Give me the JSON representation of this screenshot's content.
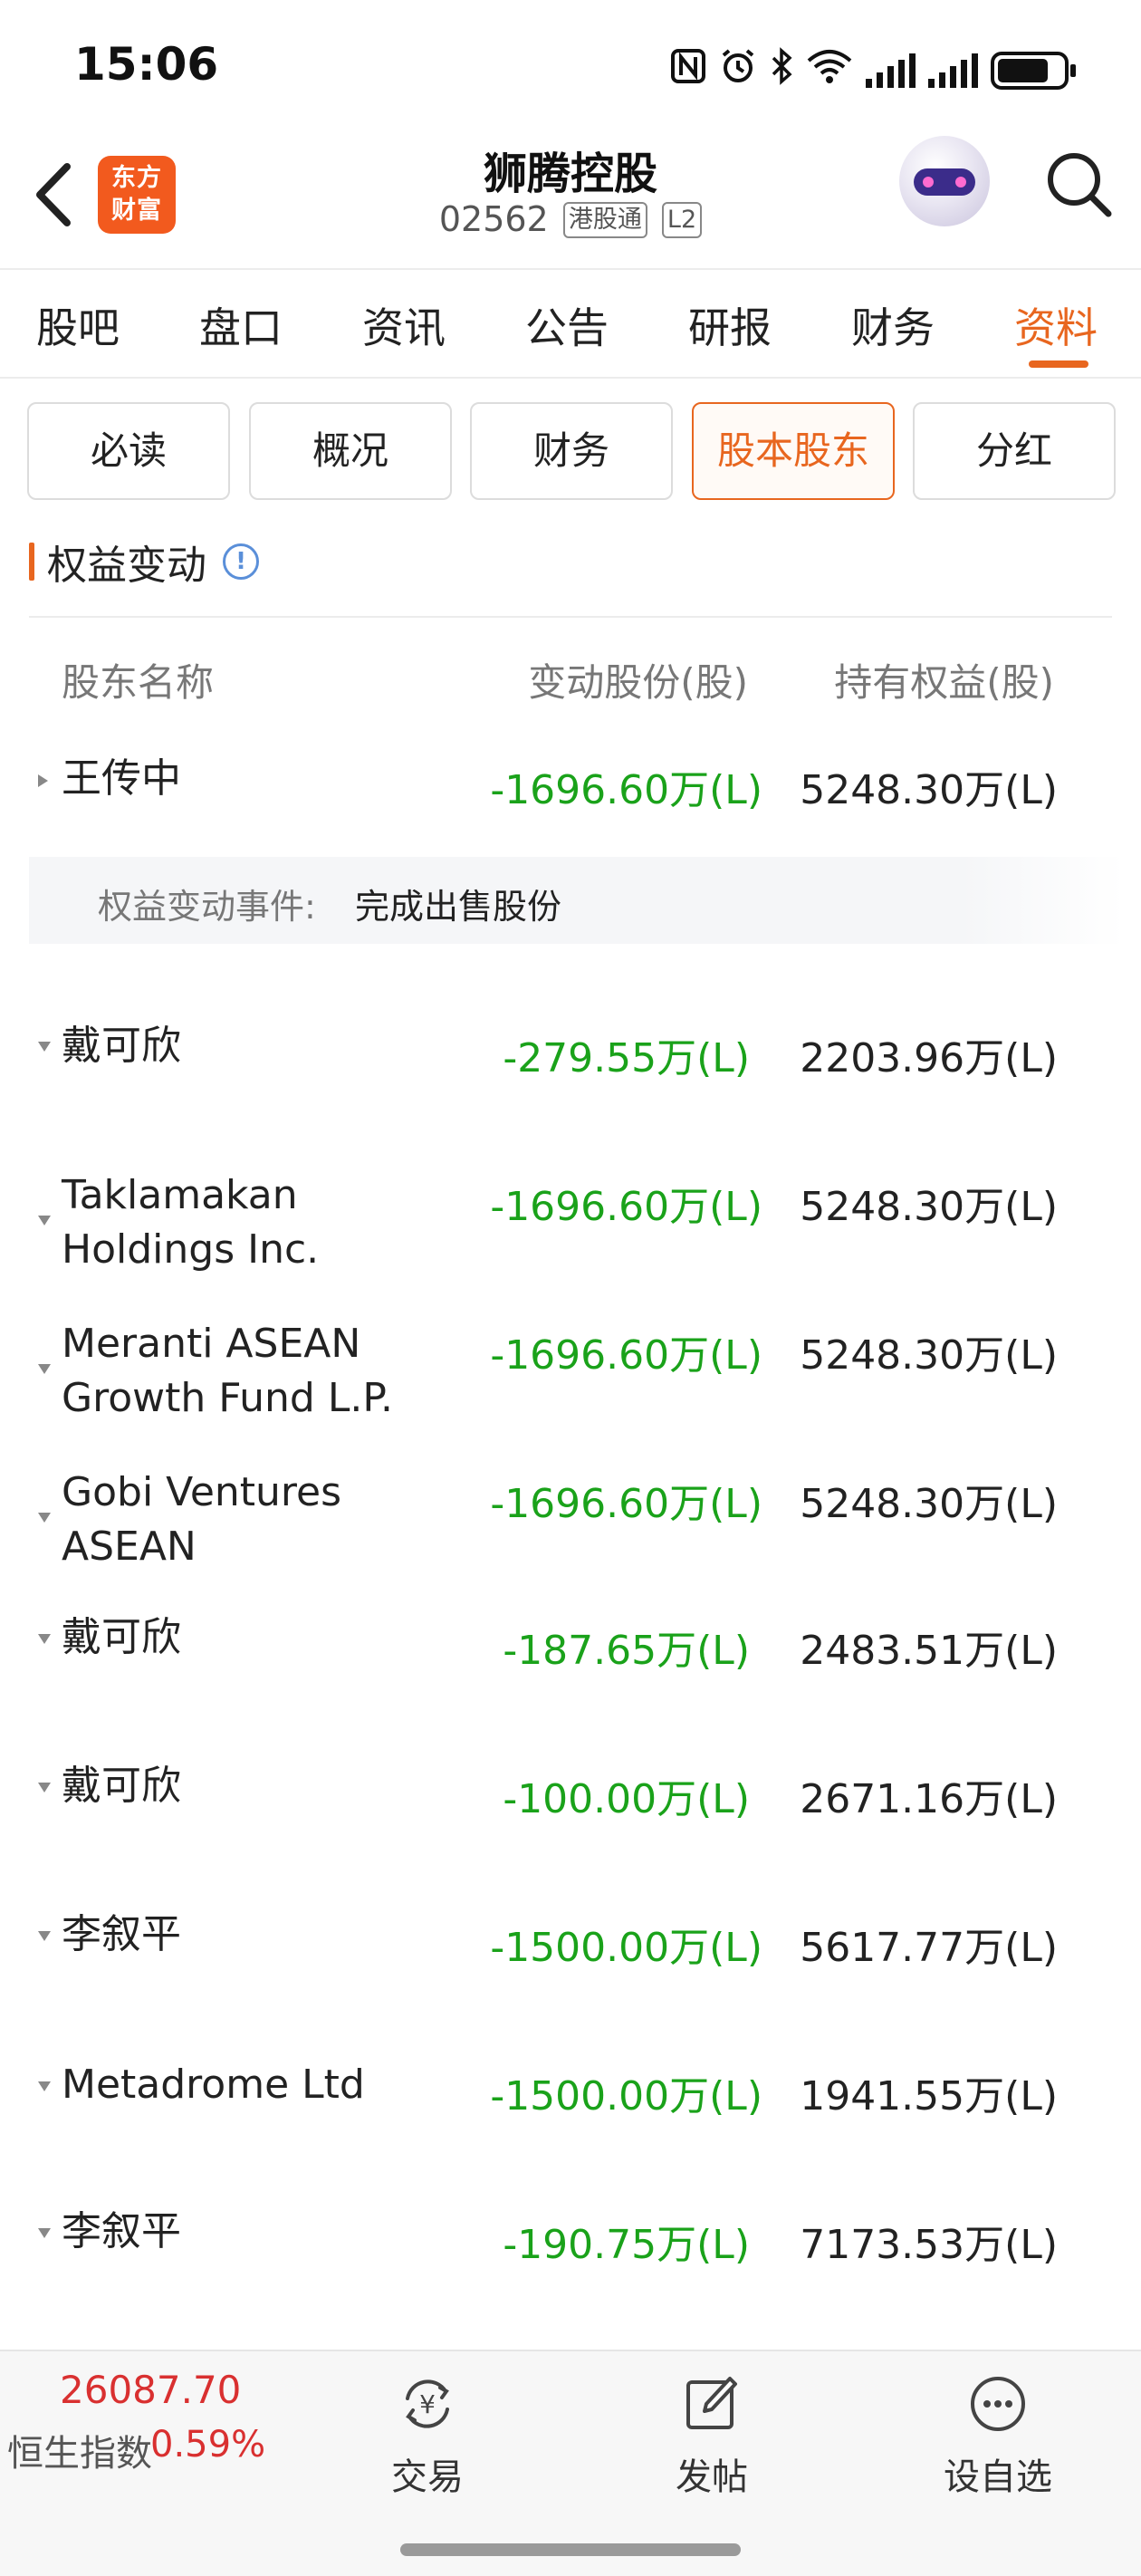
{
  "status": {
    "time": "15:06"
  },
  "header": {
    "logo_line1": "东方",
    "logo_line2": "财富",
    "stock_name": "狮腾控股",
    "stock_code": "02562",
    "tag_connect": "港股通",
    "tag_level": "L2"
  },
  "main_tabs": [
    {
      "label": "股吧"
    },
    {
      "label": "盘口"
    },
    {
      "label": "资讯"
    },
    {
      "label": "公告"
    },
    {
      "label": "研报"
    },
    {
      "label": "财务"
    },
    {
      "label": "资料",
      "active": true
    }
  ],
  "sub_tabs": [
    {
      "label": "必读"
    },
    {
      "label": "概况"
    },
    {
      "label": "财务"
    },
    {
      "label": "股本股东",
      "active": true
    },
    {
      "label": "分红"
    }
  ],
  "section": {
    "title": "权益变动",
    "info": "!"
  },
  "table": {
    "headers": {
      "name": "股东名称",
      "change": "变动股份(股)",
      "holding": "持有权益(股)"
    },
    "rows": [
      {
        "name": "王传中",
        "change": "-1696.60万(L)",
        "holding": "5248.30万(L)",
        "expanded": true
      },
      {
        "name": "戴可欣",
        "change": "-279.55万(L)",
        "holding": "2203.96万(L)"
      },
      {
        "name": "Taklamakan Holdings Inc.",
        "name_line1": "Taklamakan",
        "name_line2": "Holdings Inc.",
        "change": "-1696.60万(L)",
        "holding": "5248.30万(L)"
      },
      {
        "name": "Meranti ASEAN Growth Fund L.P.",
        "name_line1": "Meranti ASEAN",
        "name_line2": "Growth Fund L.P.",
        "change": "-1696.60万(L)",
        "holding": "5248.30万(L)"
      },
      {
        "name": "Gobi Ventures ASEAN",
        "name_line1": "Gobi Ventures",
        "name_line2": "ASEAN",
        "change": "-1696.60万(L)",
        "holding": "5248.30万(L)"
      },
      {
        "name": "戴可欣",
        "change": "-187.65万(L)",
        "holding": "2483.51万(L)"
      },
      {
        "name": "戴可欣",
        "change": "-100.00万(L)",
        "holding": "2671.16万(L)"
      },
      {
        "name": "李叙平",
        "change": "-1500.00万(L)",
        "holding": "5617.77万(L)"
      },
      {
        "name": "Metadrome Ltd",
        "change": "-1500.00万(L)",
        "holding": "1941.55万(L)"
      },
      {
        "name": "李叙平",
        "change": "-190.75万(L)",
        "holding": "7173.53万(L)"
      }
    ],
    "event": {
      "label": "权益变动事件:",
      "value": "完成出售股份"
    }
  },
  "bottom": {
    "index_value": "26087.70",
    "index_name": "恒生指数",
    "index_pct": "0.59%",
    "nav": [
      {
        "label": "交易",
        "icon": "trade-icon"
      },
      {
        "label": "发帖",
        "icon": "post-icon"
      },
      {
        "label": "设自选",
        "icon": "more-icon"
      }
    ]
  },
  "colors": {
    "accent": "#e8661f",
    "down": "#1aa21a",
    "up": "#d93030",
    "logo": "#f25a1e"
  }
}
